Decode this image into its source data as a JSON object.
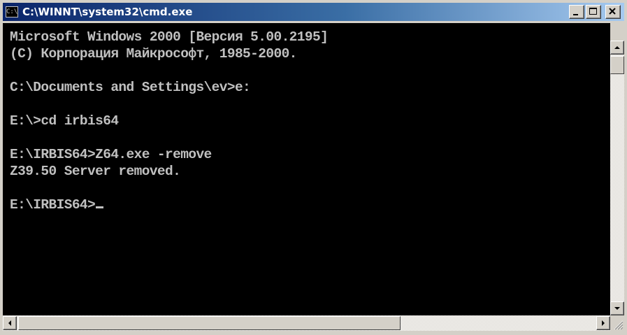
{
  "window": {
    "title": "C:\\WINNT\\system32\\cmd.exe",
    "icon": "cmd-console-icon",
    "controls": [
      "minimize-icon",
      "maximize-icon",
      "close-icon"
    ]
  },
  "console": {
    "lines": [
      "Microsoft Windows 2000 [Версия 5.00.2195]",
      "(С) Корпорация Майкрософт, 1985-2000.",
      "",
      "C:\\Documents and Settings\\ev>e:",
      "",
      "E:\\>cd irbis64",
      "",
      "E:\\IRBIS64>Z64.exe -remove",
      "Z39.50 Server removed.",
      "",
      "E:\\IRBIS64>"
    ]
  },
  "colors": {
    "console_background": "#000000",
    "console_text": "#c0c0c0",
    "titlebar_start": "#0a246a",
    "titlebar_end": "#a6caf0"
  }
}
